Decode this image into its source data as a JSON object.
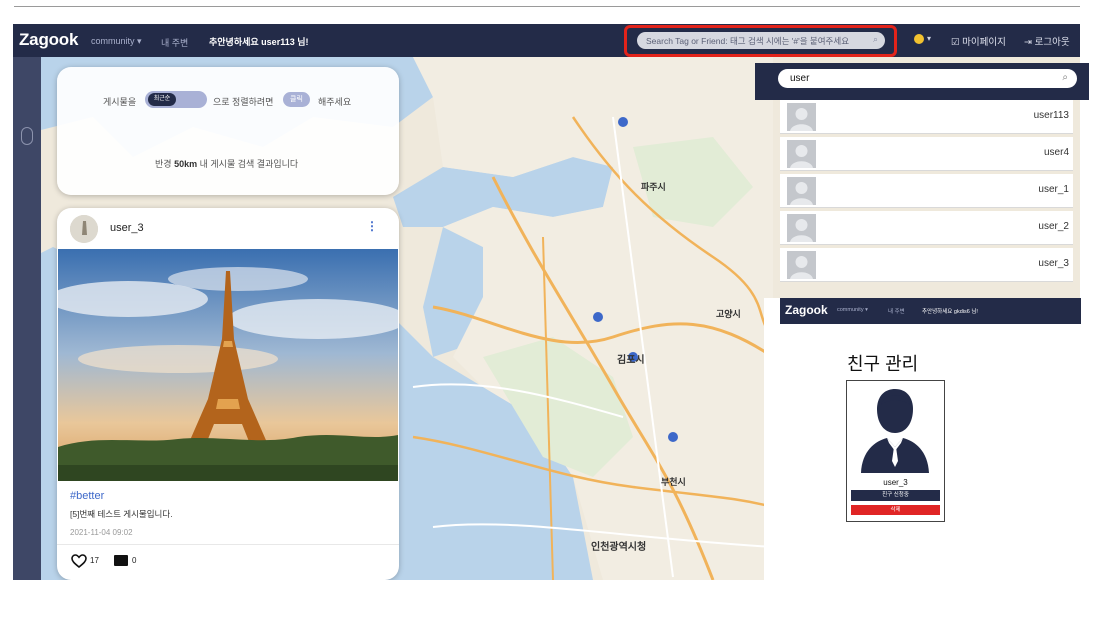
{
  "navbar": {
    "logo": "Zagook",
    "community": "community ▾",
    "nearby": "내 주변",
    "greeting": "추안녕하세요 user113 님!",
    "search_placeholder": "Search Tag or Friend: 태그 검색 시에는 '#'을 붙여주세요",
    "mypage": "마이페이지",
    "logout": "로그아웃"
  },
  "filter": {
    "prefix": "게시물을",
    "toggle_label": "최근순",
    "middle": "으로 정렬하려면",
    "click_label": "클릭",
    "suffix": "해주세요",
    "radius_prefix": "반경",
    "radius_value": "50km",
    "radius_suffix": "내 게시물 검색 결과입니다"
  },
  "post": {
    "username": "user_3",
    "tag": "#better",
    "body": "[5]번째 테스트 게시물입니다.",
    "date": "2021-11-04 09:02",
    "likes": "17",
    "comments": "0"
  },
  "search_results": {
    "query": "user",
    "items": [
      "user113",
      "user4",
      "user_1",
      "user_2",
      "user_3"
    ]
  },
  "friend_panel": {
    "logo": "Zagook",
    "community": "community ▾",
    "nearby": "내 주변",
    "greeting": "추안녕하세요 gkdis6 님!",
    "title": "친구 관리",
    "friend_name": "user_3",
    "request_button": "친구 신청중",
    "delete_button": "삭제"
  },
  "map_labels": {
    "paju": "파주시",
    "goyang": "고양시",
    "gimpo": "김포시",
    "bucheon": "부천시",
    "incheon": "인천광역시청"
  },
  "colors": {
    "navy": "#232b48",
    "accent_blue": "#3d68c9",
    "highlight_red": "#e2231a",
    "delete_red": "#e02525"
  }
}
